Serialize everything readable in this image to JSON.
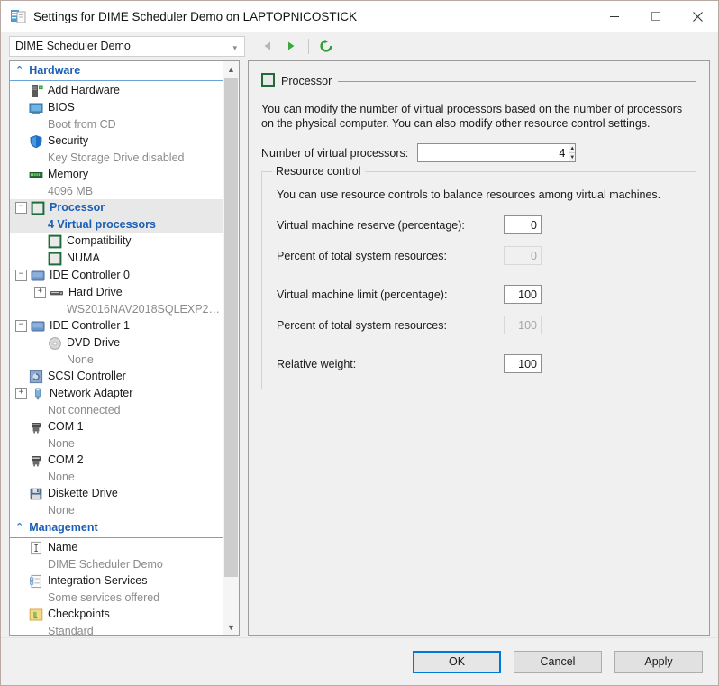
{
  "window": {
    "title": "Settings for DIME Scheduler Demo on LAPTOPNICOSTICK",
    "icon": "settings-vm-icon",
    "minimize_label": "—",
    "maximize_label": "□",
    "close_label": "✕"
  },
  "toolbar": {
    "vm_selected": "DIME Scheduler Demo",
    "caret": "⌄",
    "back_label": "Back",
    "forward_label": "Forward",
    "refresh_label": "Refresh"
  },
  "sidebar": {
    "sections": [
      {
        "label": "Hardware",
        "items": [
          {
            "label": "Add Hardware",
            "sub": null,
            "icon": "add-hardware-icon",
            "expander": null,
            "indent": 0,
            "selected": false
          },
          {
            "label": "BIOS",
            "sub": "Boot from CD",
            "icon": "bios-icon",
            "expander": null,
            "indent": 0,
            "selected": false
          },
          {
            "label": "Security",
            "sub": "Key Storage Drive disabled",
            "icon": "security-shield-icon",
            "expander": null,
            "indent": 0,
            "selected": false
          },
          {
            "label": "Memory",
            "sub": "4096 MB",
            "icon": "memory-icon",
            "expander": null,
            "indent": 0,
            "selected": false
          },
          {
            "label": "Processor",
            "sub": "4 Virtual processors",
            "icon": "processor-icon",
            "expander": "minus",
            "indent": 0,
            "selected": true
          },
          {
            "label": "Compatibility",
            "sub": null,
            "icon": "processor-icon",
            "expander": null,
            "indent": 1,
            "selected": false
          },
          {
            "label": "NUMA",
            "sub": null,
            "icon": "processor-icon",
            "expander": null,
            "indent": 1,
            "selected": false
          },
          {
            "label": "IDE Controller 0",
            "sub": null,
            "icon": "ide-controller-icon",
            "expander": "minus",
            "indent": 0,
            "selected": false
          },
          {
            "label": "Hard Drive",
            "sub": "WS2016NAV2018SQLEXP2…",
            "icon": "hard-drive-icon",
            "expander": "plus",
            "indent": 1,
            "selected": false
          },
          {
            "label": "IDE Controller 1",
            "sub": null,
            "icon": "ide-controller-icon",
            "expander": "minus",
            "indent": 0,
            "selected": false
          },
          {
            "label": "DVD Drive",
            "sub": "None",
            "icon": "dvd-drive-icon",
            "expander": null,
            "indent": 1,
            "selected": false
          },
          {
            "label": "SCSI Controller",
            "sub": null,
            "icon": "scsi-controller-icon",
            "expander": null,
            "indent": 0,
            "selected": false
          },
          {
            "label": "Network Adapter",
            "sub": "Not connected",
            "icon": "network-adapter-icon",
            "expander": "plus",
            "indent": 0,
            "selected": false
          },
          {
            "label": "COM 1",
            "sub": "None",
            "icon": "com-port-icon",
            "expander": null,
            "indent": 0,
            "selected": false
          },
          {
            "label": "COM 2",
            "sub": "None",
            "icon": "com-port-icon",
            "expander": null,
            "indent": 0,
            "selected": false
          },
          {
            "label": "Diskette Drive",
            "sub": "None",
            "icon": "diskette-drive-icon",
            "expander": null,
            "indent": 0,
            "selected": false
          }
        ]
      },
      {
        "label": "Management",
        "items": [
          {
            "label": "Name",
            "sub": "DIME Scheduler Demo",
            "icon": "name-icon",
            "expander": null,
            "indent": 0,
            "selected": false
          },
          {
            "label": "Integration Services",
            "sub": "Some services offered",
            "icon": "integration-services-icon",
            "expander": null,
            "indent": 0,
            "selected": false
          },
          {
            "label": "Checkpoints",
            "sub": "Standard",
            "icon": "checkpoints-icon",
            "expander": null,
            "indent": 0,
            "selected": false
          }
        ]
      }
    ]
  },
  "main": {
    "group_title": "Processor",
    "group_icon": "processor-icon",
    "description": "You can modify the number of virtual processors based on the number of processors on the physical computer. You can also modify other resource control settings.",
    "processor_count_label": "Number of virtual processors:",
    "processor_count_value": "4",
    "resource_control": {
      "legend": "Resource control",
      "description": "You can use resource controls to balance resources among virtual machines.",
      "fields": [
        {
          "label": "Virtual machine reserve (percentage):",
          "value": "0",
          "readonly": false
        },
        {
          "label": "Percent of total system resources:",
          "value": "0",
          "readonly": true
        },
        {
          "label": "Virtual machine limit (percentage):",
          "value": "100",
          "readonly": false
        },
        {
          "label": "Percent of total system resources:",
          "value": "100",
          "readonly": true
        },
        {
          "label": "Relative weight:",
          "value": "100",
          "readonly": false
        }
      ]
    }
  },
  "footer": {
    "ok_label": "OK",
    "cancel_label": "Cancel",
    "apply_label": "Apply"
  },
  "colors": {
    "accent": "#1a5fb4",
    "focus": "#0078d7",
    "green": "#3aa83a"
  }
}
